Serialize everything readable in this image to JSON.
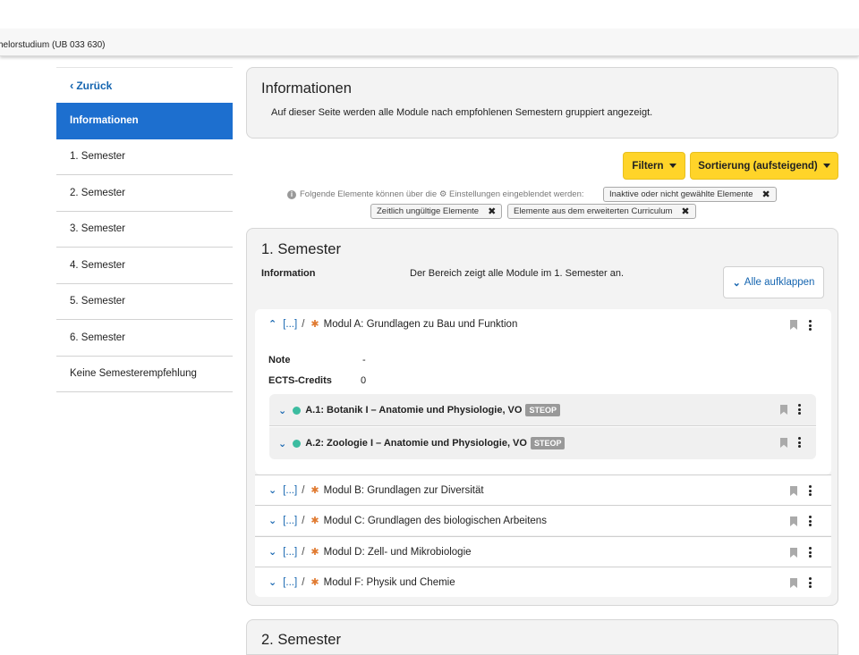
{
  "header": {
    "breadcrumb": "helorstudium (UB 033 630)"
  },
  "sidebar": {
    "back_label": "Zurück",
    "items": [
      {
        "label": "Informationen",
        "active": true
      },
      {
        "label": "1. Semester"
      },
      {
        "label": "2. Semester"
      },
      {
        "label": "3. Semester"
      },
      {
        "label": "4. Semester"
      },
      {
        "label": "5. Semester"
      },
      {
        "label": "6. Semester"
      },
      {
        "label": "Keine Semesterempfehlung"
      }
    ]
  },
  "info": {
    "title": "Informationen",
    "text": "Auf dieser Seite werden alle Module nach empfohlenen Semestern gruppiert angezeigt."
  },
  "toolbar": {
    "filter_label": "Filtern",
    "sort_label": "Sortierung (aufsteigend)"
  },
  "hint": {
    "text_before": "Folgende Elemente können über die",
    "text_after": "Einstellungen eingeblendet werden:",
    "chips": [
      "Inaktive oder nicht gewählte Elemente",
      "Zeitlich ungültige Elemente",
      "Elemente aus dem erweiterten Curriculum"
    ]
  },
  "semester1": {
    "title": "1. Semester",
    "info_label": "Information",
    "info_text": "Der Bereich zeigt alle Module im 1. Semester an.",
    "expand_label": "Alle aufklappen",
    "open_module": {
      "prefix": "[...]",
      "title": "Modul A: Grundlagen zu Bau und Funktion",
      "note_label": "Note",
      "note_value": "-",
      "ects_label": "ECTS-Credits",
      "ects_value": "0",
      "courses": [
        {
          "title": "A.1: Botanik I – Anatomie und Physiologie, VO",
          "badge": "STEOP"
        },
        {
          "title": "A.2: Zoologie I – Anatomie und Physiologie, VO",
          "badge": "STEOP"
        }
      ]
    },
    "modules": [
      {
        "prefix": "[...]",
        "title": "Modul B: Grundlagen zur Diversität"
      },
      {
        "prefix": "[...]",
        "title": "Modul C: Grundlagen des biologischen Arbeitens"
      },
      {
        "prefix": "[...]",
        "title": "Modul D: Zell- und Mikrobiologie"
      },
      {
        "prefix": "[...]",
        "title": "Modul F: Physik und Chemie"
      }
    ]
  },
  "semester2": {
    "title": "2. Semester"
  },
  "colors": {
    "accent": "#1d6fcf",
    "button_yellow": "#ffd429",
    "steop_badge": "#999999",
    "status_green": "#3cbca0"
  },
  "icons": [
    "chevron-left-icon",
    "caret-down-icon",
    "info-icon",
    "gear-icon",
    "close-icon",
    "chevron-up-icon",
    "chevron-down-icon",
    "asterisk-icon",
    "bookmark-icon",
    "kebab-menu-icon",
    "status-dot-icon"
  ]
}
